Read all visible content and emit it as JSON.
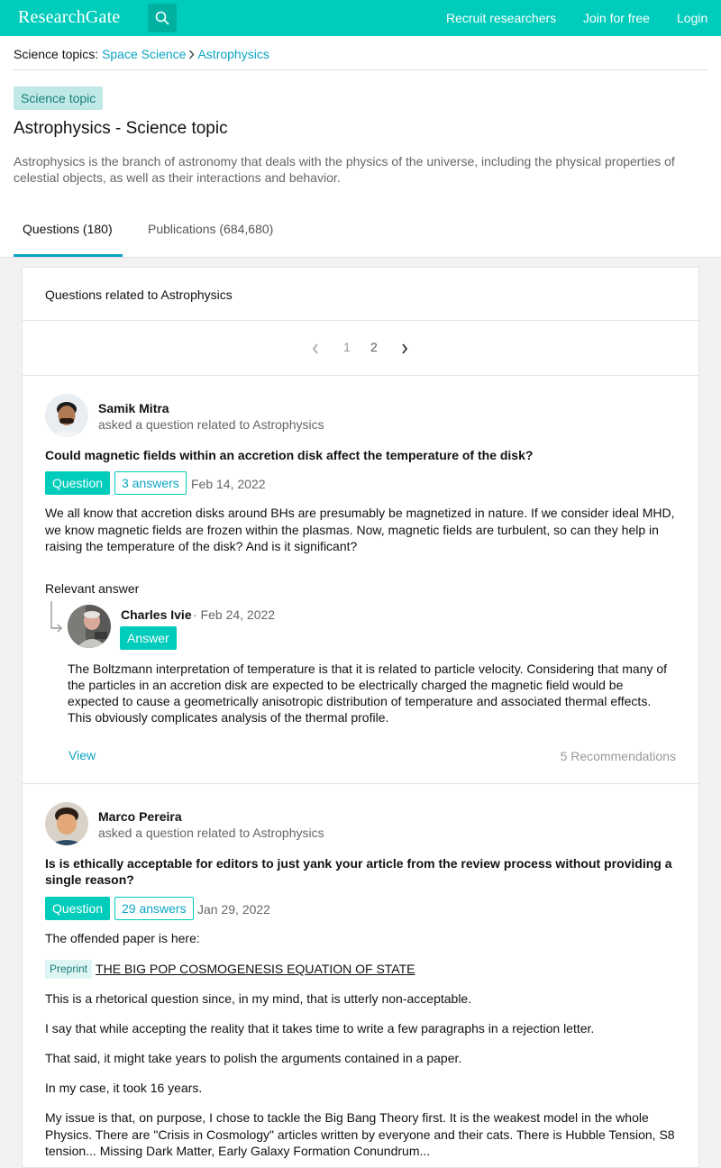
{
  "topbar": {
    "logo": "ResearchGate",
    "nav": [
      "Recruit researchers",
      "Join for free",
      "Login"
    ],
    "colors": {
      "brand": "#00ccbb",
      "link": "#0ba5c2"
    }
  },
  "breadcrumb": {
    "prefix": "Science topics:",
    "items": [
      "Space Science",
      "Astrophysics"
    ]
  },
  "topic": {
    "badge": "Science topic",
    "title": "Astrophysics - Science topic",
    "description": "Astrophysics is the branch of astronomy that deals with the physics of the universe, including the physical properties of celestial objects, as well as their interactions and behavior."
  },
  "tabs": [
    {
      "label": "Questions (180)",
      "active": true
    },
    {
      "label": "Publications (684,680)",
      "active": false
    }
  ],
  "card": {
    "heading": "Questions related to Astrophysics",
    "pagination": {
      "pages": [
        "1",
        "2"
      ],
      "current": "2"
    }
  },
  "questions": [
    {
      "author": "Samik Mitra",
      "asked": "asked a question related to Astrophysics",
      "title": "Could magnetic fields within an accretion disk affect the temperature of the disk?",
      "tag": "Question",
      "answers": "3 answers",
      "date": "Feb 14, 2022",
      "body": "We all know that accretion disks around BHs are presumably be magnetized in nature. If we consider ideal MHD, we know magnetic fields are frozen within the plasmas. Now, magnetic fields are turbulent, so can they help in raising the temperature of the disk? And is it significant?",
      "relevant_label": "Relevant answer",
      "answer": {
        "author": "Charles Ivie",
        "date": "· Feb 24, 2022",
        "tag": "Answer",
        "text": "The Boltzmann interpretation of temperature is that it is related to particle velocity. Considering that many of the particles in an accretion disk are expected to be electrically charged the magnetic field would be expected to cause a geometrically anisotropic distribution of temperature and associated thermal effects. This obviously complicates analysis of the thermal profile.",
        "view": "View",
        "recommendations": "5 Recommendations"
      }
    },
    {
      "author": "Marco Pereira",
      "asked": "asked a question related to Astrophysics",
      "title": "Is is ethically acceptable for editors to just yank your article from the review process without providing a single reason?",
      "tag": "Question",
      "answers": "29 answers",
      "date": "Jan 29, 2022",
      "paragraphs": [
        "The offended paper is here:",
        "This is a rhetorical question since, in my mind, that is utterly non-acceptable.",
        "I say that while accepting the reality that it takes time to write a few paragraphs in a rejection letter.",
        "That said, it might take years to polish the arguments contained in a paper.",
        "In my case, it took 16 years.",
        "My issue is that, on purpose, I chose to tackle the Big Bang Theory first. It is the weakest model in the whole Physics. There are \"Crisis in Cosmology\" articles written by everyone and their cats. There is Hubble Tension, S8 tension... Missing Dark Matter, Early Galaxy Formation Conundrum..."
      ],
      "preprint": {
        "badge": "Preprint",
        "title": "THE BIG POP COSMOGENESIS EQUATION OF STATE"
      }
    }
  ]
}
